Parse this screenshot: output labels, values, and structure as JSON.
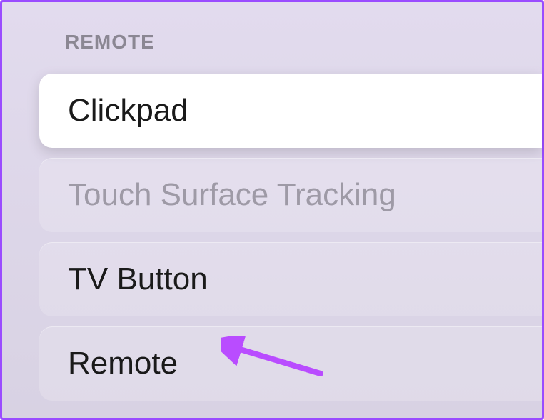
{
  "section": {
    "header": "REMOTE"
  },
  "items": [
    {
      "label": "Clickpad",
      "selected": true,
      "disabled": false
    },
    {
      "label": "Touch Surface Tracking",
      "selected": false,
      "disabled": true
    },
    {
      "label": "TV Button",
      "selected": false,
      "disabled": false
    },
    {
      "label": "Remote",
      "selected": false,
      "disabled": false
    }
  ],
  "annotation": {
    "arrow_color": "#b94cff"
  }
}
